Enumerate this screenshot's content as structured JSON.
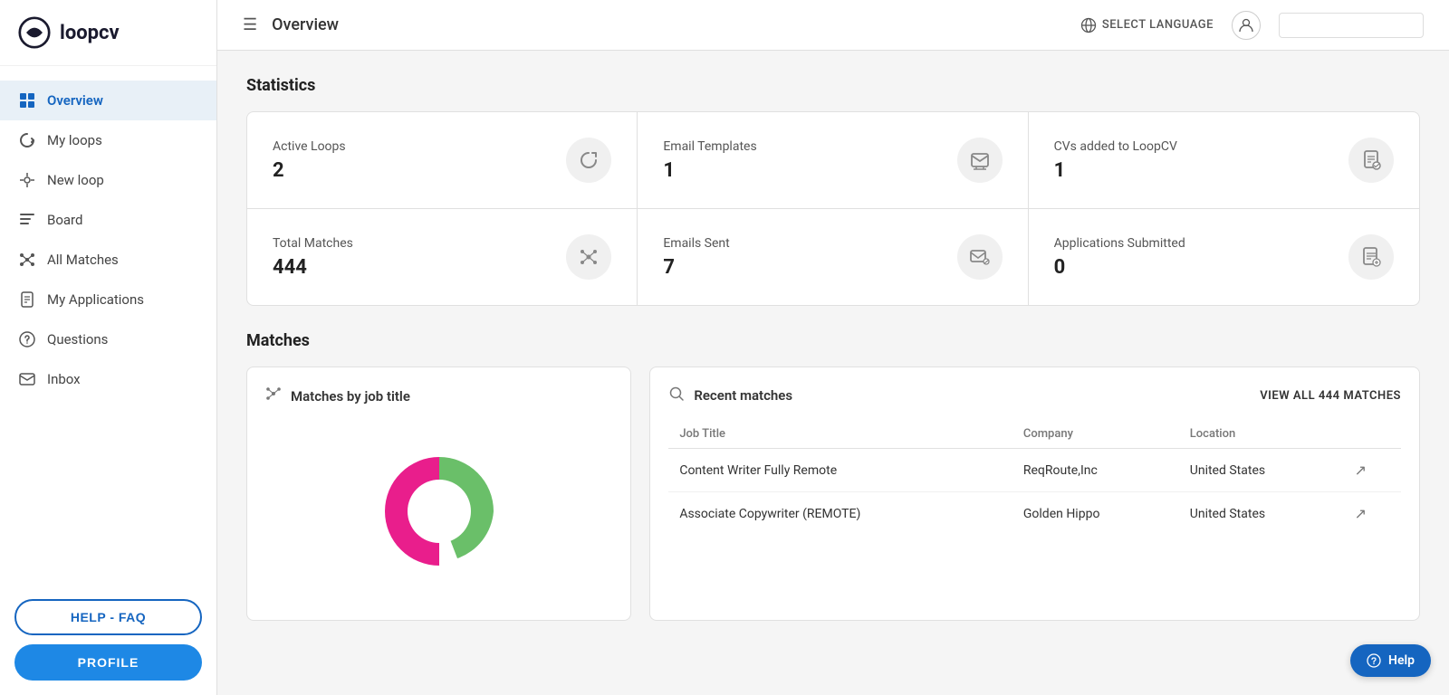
{
  "app": {
    "logo_text": "loopcv",
    "page_title": "Overview",
    "language_label": "SELECT LANGUAGE"
  },
  "sidebar": {
    "items": [
      {
        "id": "overview",
        "label": "Overview",
        "active": true
      },
      {
        "id": "my-loops",
        "label": "My loops",
        "active": false
      },
      {
        "id": "new-loop",
        "label": "New loop",
        "active": false
      },
      {
        "id": "board",
        "label": "Board",
        "active": false
      },
      {
        "id": "all-matches",
        "label": "All Matches",
        "active": false
      },
      {
        "id": "my-applications",
        "label": "My Applications",
        "active": false
      },
      {
        "id": "questions",
        "label": "Questions",
        "active": false
      },
      {
        "id": "inbox",
        "label": "Inbox",
        "active": false
      }
    ],
    "help_btn": "HELP - FAQ",
    "profile_btn": "PROFILE"
  },
  "statistics": {
    "section_title": "Statistics",
    "cards": [
      {
        "id": "active-loops",
        "label": "Active Loops",
        "value": "2",
        "icon": "↻"
      },
      {
        "id": "email-templates",
        "label": "Email Templates",
        "value": "1",
        "icon": "✉"
      },
      {
        "id": "cvs-added",
        "label": "CVs added to LoopCV",
        "value": "1",
        "icon": "📄"
      },
      {
        "id": "total-matches",
        "label": "Total Matches",
        "value": "444",
        "icon": "⋯"
      },
      {
        "id": "emails-sent",
        "label": "Emails Sent",
        "value": "7",
        "icon": "✉"
      },
      {
        "id": "applications-submitted",
        "label": "Applications Submitted",
        "value": "0",
        "icon": "📋"
      }
    ]
  },
  "matches": {
    "section_title": "Matches",
    "chart_card": {
      "title": "Matches by job title",
      "icon": "⋯"
    },
    "recent_card": {
      "title": "Recent matches",
      "view_all_label": "VIEW ALL 444 MATCHES",
      "columns": [
        "Job Title",
        "Company",
        "Location"
      ],
      "rows": [
        {
          "job_title": "Content Writer Fully Remote",
          "company": "ReqRoute,Inc",
          "location": "United States"
        },
        {
          "job_title": "Associate Copywriter (REMOTE)",
          "company": "Golden Hippo",
          "location": "United States"
        }
      ]
    }
  },
  "help_float": {
    "label": "Help"
  }
}
